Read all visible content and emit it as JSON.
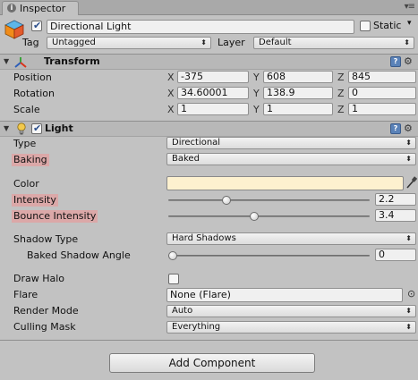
{
  "tab": {
    "label": "Inspector"
  },
  "header": {
    "object_name": "Directional Light",
    "active": true,
    "static_label": "Static",
    "static_checked": false,
    "tag_label": "Tag",
    "tag_value": "Untagged",
    "layer_label": "Layer",
    "layer_value": "Default"
  },
  "transform": {
    "title": "Transform",
    "rows": [
      {
        "label": "Position",
        "x": "-375",
        "y": "608",
        "z": "845"
      },
      {
        "label": "Rotation",
        "x": "34.60001",
        "y": "138.9",
        "z": "0"
      },
      {
        "label": "Scale",
        "x": "1",
        "y": "1",
        "z": "1"
      }
    ],
    "axis": {
      "x": "X",
      "y": "Y",
      "z": "Z"
    }
  },
  "light": {
    "title": "Light",
    "enabled": true,
    "type_label": "Type",
    "type_value": "Directional",
    "baking_label": "Baking",
    "baking_value": "Baked",
    "color_label": "Color",
    "color_value": "#fdf1cf",
    "intensity_label": "Intensity",
    "intensity_value": "2.2",
    "intensity_fraction": 0.28,
    "bounce_label": "Bounce Intensity",
    "bounce_value": "3.4",
    "bounce_fraction": 0.425,
    "shadow_type_label": "Shadow Type",
    "shadow_type_value": "Hard Shadows",
    "baked_angle_label": "Baked Shadow Angle",
    "baked_angle_value": "0",
    "baked_angle_fraction": 0.0,
    "draw_halo_label": "Draw Halo",
    "draw_halo_checked": false,
    "flare_label": "Flare",
    "flare_value": "None (Flare)",
    "render_mode_label": "Render Mode",
    "render_mode_value": "Auto",
    "culling_label": "Culling Mask",
    "culling_value": "Everything"
  },
  "add_component_label": "Add Component",
  "colors": {
    "highlight": "#dba8a8",
    "panel_bg": "#c2c2c2"
  }
}
